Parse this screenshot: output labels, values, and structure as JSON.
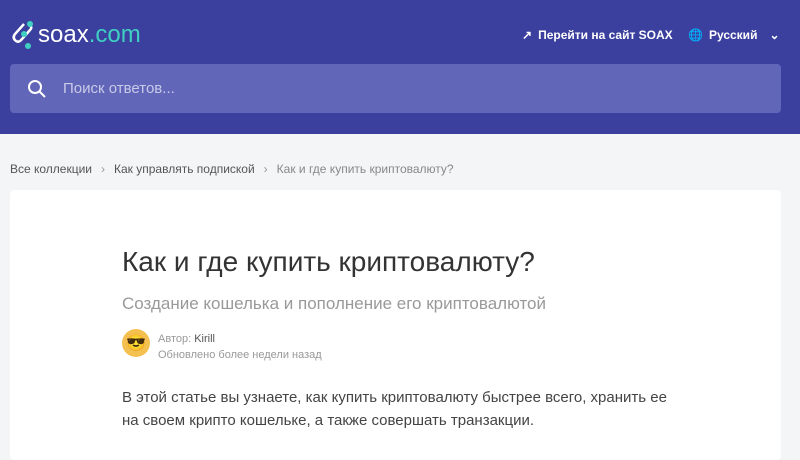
{
  "header": {
    "logo_main": "soax",
    "logo_tld": ".com",
    "site_link": "Перейти на сайт SOAX",
    "language": "Русский"
  },
  "search": {
    "placeholder": "Поиск ответов..."
  },
  "breadcrumb": [
    "Все коллекции",
    "Как управлять подпиской",
    "Как и где купить криптовалюту?"
  ],
  "article": {
    "title": "Как и где купить криптовалюту?",
    "subtitle": "Создание кошелька и пополнение его криптовалютой",
    "author_label": "Автор:",
    "author": "Kirill",
    "updated": "Обновлено более недели назад",
    "intro": "В этой статье вы узнаете, как купить криптовалюту быстрее всего, хранить ее на своем крипто кошельке, а также совершать транзакции."
  }
}
